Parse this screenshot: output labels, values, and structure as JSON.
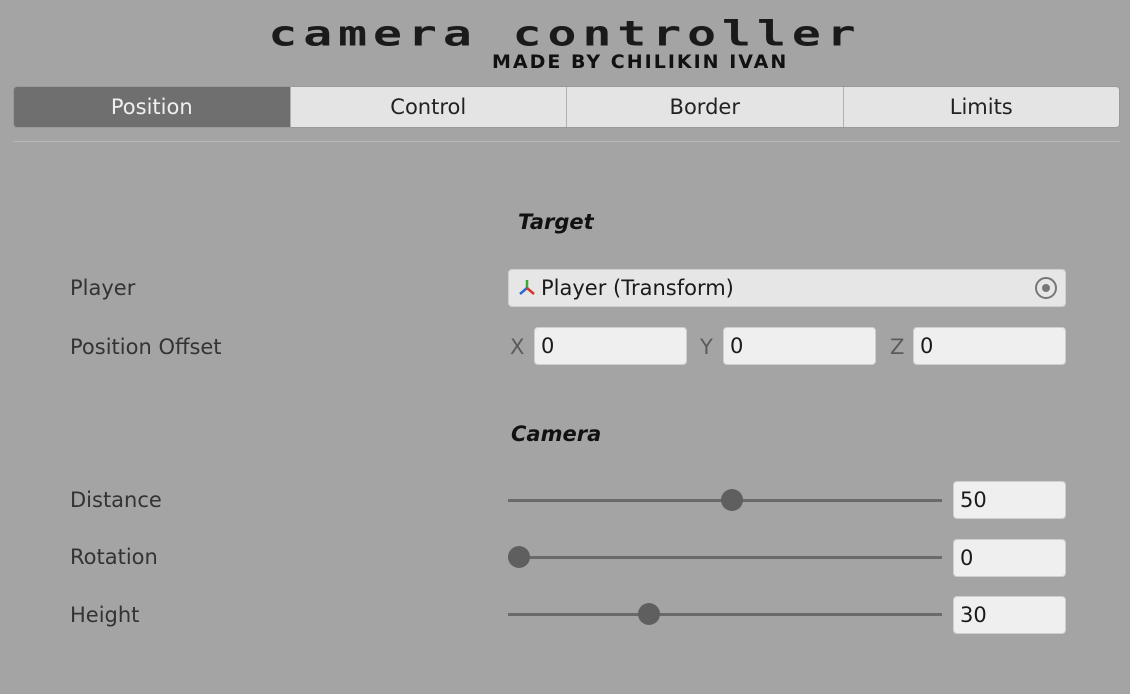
{
  "header": {
    "title": "camera controller",
    "subtitle": "MADE BY CHILIKIN IVAN"
  },
  "tabs": [
    {
      "label": "Position",
      "active": true
    },
    {
      "label": "Control",
      "active": false
    },
    {
      "label": "Border",
      "active": false
    },
    {
      "label": "Limits",
      "active": false
    }
  ],
  "target": {
    "heading": "Target",
    "player_label": "Player",
    "player_value": "Player (Transform)",
    "offset_label": "Position Offset",
    "offset": {
      "x_label": "X",
      "x": "0",
      "y_label": "Y",
      "y": "0",
      "z_label": "Z",
      "z": "0"
    }
  },
  "camera": {
    "heading": "Camera",
    "distance_label": "Distance",
    "distance_value": "50",
    "distance_fraction": 0.49,
    "rotation_label": "Rotation",
    "rotation_value": "0",
    "rotation_fraction": 0.0,
    "height_label": "Height",
    "height_value": "30",
    "height_fraction": 0.3
  },
  "colors": {
    "background": "#a4a4a4",
    "active_tab": "#6f6f6f",
    "tab": "#e4e4e4",
    "field": "#efefef"
  }
}
